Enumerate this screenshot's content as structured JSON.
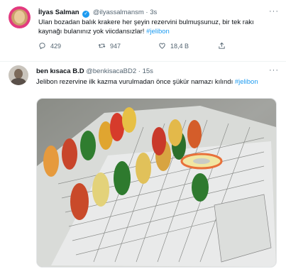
{
  "tweet1": {
    "name": "İlyas Salman",
    "handle": "@ilyassalmansm",
    "sep": "·",
    "time": "3s",
    "text_line1": "Ulan bozadan balık krakere her şeyin rezervini bulmuşsunuz, bir tek rakı",
    "text_line2_pre": "kaynağı bulanınız yok viicdansızlar! ",
    "hashtag": "#jelibon",
    "replies": "429",
    "retweets": "947",
    "likes": "18,4 B",
    "more": "···",
    "icons": [
      "verified-icon",
      "reply-icon",
      "retweet-icon",
      "like-icon",
      "share-icon"
    ]
  },
  "tweet2": {
    "name": "ben kısaca B.D",
    "handle": "@benkisacaBD2",
    "sep": "·",
    "time": "15s",
    "text_pre": "Jelibon rezervine ilk kazma vurulmadan önce şükür namazı kılındı ",
    "hashtag": "#jelibon",
    "more": "···"
  },
  "colors": {
    "accent": "#1d9bf0",
    "text": "#0f1419",
    "muted": "#536471"
  }
}
